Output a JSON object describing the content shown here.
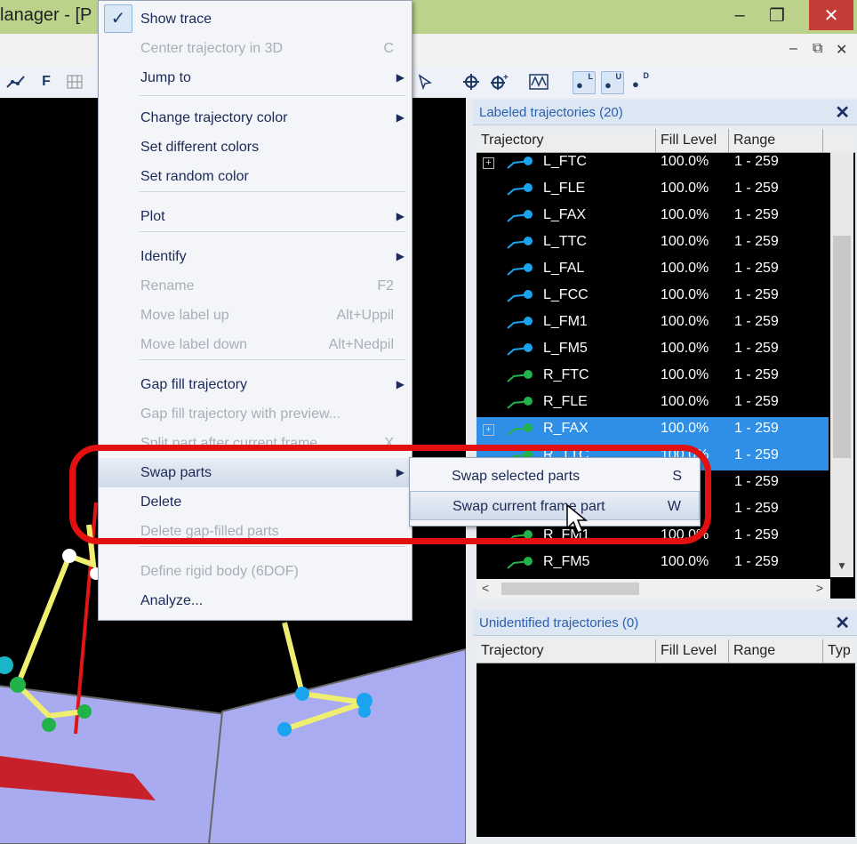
{
  "window": {
    "title": "lanager - [P",
    "controls": {
      "minimize": "–",
      "restore": "❐",
      "close": "✕"
    },
    "mdi_controls": {
      "minimize": "–",
      "restore": "⧉",
      "close": "✕"
    }
  },
  "toolbar": {
    "f_label": "F",
    "marker_labels": [
      "L",
      "U",
      "D"
    ]
  },
  "context_menu": {
    "items": [
      {
        "label": "Show trace",
        "shortcut": "",
        "submenu": false,
        "enabled": true,
        "checked": true
      },
      {
        "label": "Center trajectory in 3D",
        "shortcut": "C",
        "submenu": false,
        "enabled": false
      },
      {
        "label": "Jump to",
        "shortcut": "",
        "submenu": true,
        "enabled": true
      },
      {
        "label": "Change trajectory color",
        "shortcut": "",
        "submenu": true,
        "enabled": true
      },
      {
        "label": "Set different colors",
        "shortcut": "",
        "submenu": false,
        "enabled": true
      },
      {
        "label": "Set random color",
        "shortcut": "",
        "submenu": false,
        "enabled": true
      },
      {
        "label": "Plot",
        "shortcut": "",
        "submenu": true,
        "enabled": true
      },
      {
        "label": "Identify",
        "shortcut": "",
        "submenu": true,
        "enabled": true
      },
      {
        "label": "Rename",
        "shortcut": "F2",
        "submenu": false,
        "enabled": false
      },
      {
        "label": "Move label up",
        "shortcut": "Alt+Uppil",
        "submenu": false,
        "enabled": false
      },
      {
        "label": "Move label down",
        "shortcut": "Alt+Nedpil",
        "submenu": false,
        "enabled": false
      },
      {
        "label": "Gap fill trajectory",
        "shortcut": "",
        "submenu": true,
        "enabled": true
      },
      {
        "label": "Gap fill trajectory with preview...",
        "shortcut": "",
        "submenu": false,
        "enabled": false
      },
      {
        "label": "Split part after current frame",
        "shortcut": "X",
        "submenu": false,
        "enabled": false
      },
      {
        "label": "Swap parts",
        "shortcut": "",
        "submenu": true,
        "enabled": true,
        "highlighted": true
      },
      {
        "label": "Delete",
        "shortcut": "",
        "submenu": false,
        "enabled": true
      },
      {
        "label": "Delete gap-filled parts",
        "shortcut": "",
        "submenu": false,
        "enabled": false
      },
      {
        "label": "Define rigid body (6DOF)",
        "shortcut": "",
        "submenu": false,
        "enabled": false
      },
      {
        "label": "Analyze...",
        "shortcut": "",
        "submenu": false,
        "enabled": true
      }
    ],
    "check_glyph": "✓",
    "arrow_glyph": "▶"
  },
  "submenu": {
    "items": [
      {
        "label": "Swap selected parts",
        "shortcut": "S"
      },
      {
        "label": "Swap current frame part",
        "shortcut": "W",
        "hovered": true
      }
    ]
  },
  "labeled_panel": {
    "title": "Labeled trajectories (20)",
    "close": "✕",
    "columns": [
      "Trajectory",
      "Fill Level",
      "Range"
    ],
    "rows": [
      {
        "name": "L_FTC",
        "fill": "100.0%",
        "range": "1 - 259",
        "color": "#1aa4f0",
        "expand": "+",
        "selected": false
      },
      {
        "name": "L_FLE",
        "fill": "100.0%",
        "range": "1 - 259",
        "color": "#1aa4f0",
        "selected": false
      },
      {
        "name": "L_FAX",
        "fill": "100.0%",
        "range": "1 - 259",
        "color": "#1aa4f0",
        "selected": false
      },
      {
        "name": "L_TTC",
        "fill": "100.0%",
        "range": "1 - 259",
        "color": "#1aa4f0",
        "selected": false
      },
      {
        "name": "L_FAL",
        "fill": "100.0%",
        "range": "1 - 259",
        "color": "#1aa4f0",
        "selected": false
      },
      {
        "name": "L_FCC",
        "fill": "100.0%",
        "range": "1 - 259",
        "color": "#1aa4f0",
        "selected": false
      },
      {
        "name": "L_FM1",
        "fill": "100.0%",
        "range": "1 - 259",
        "color": "#1aa4f0",
        "selected": false
      },
      {
        "name": "L_FM5",
        "fill": "100.0%",
        "range": "1 - 259",
        "color": "#1aa4f0",
        "selected": false
      },
      {
        "name": "R_FTC",
        "fill": "100.0%",
        "range": "1 - 259",
        "color": "#21b24a",
        "selected": false
      },
      {
        "name": "R_FLE",
        "fill": "100.0%",
        "range": "1 - 259",
        "color": "#21b24a",
        "selected": false
      },
      {
        "name": "R_FAX",
        "fill": "100.0%",
        "range": "1 - 259",
        "color": "#21b24a",
        "expand": "+",
        "selected": true
      },
      {
        "name": "R_TTC",
        "fill": "100.0%",
        "range": "1 - 259",
        "color": "#21b24a",
        "selected": true
      },
      {
        "name": "",
        "fill": "",
        "range": "1 - 259",
        "color": "#21b24a",
        "selected": false
      },
      {
        "name": "",
        "fill": "",
        "range": "1 - 259",
        "color": "#21b24a",
        "selected": false
      },
      {
        "name": "R_FM1",
        "fill": "100.0%",
        "range": "1 - 259",
        "color": "#21b24a",
        "selected": false
      },
      {
        "name": "R_FM5",
        "fill": "100.0%",
        "range": "1 - 259",
        "color": "#21b24a",
        "selected": false
      }
    ]
  },
  "unidentified_panel": {
    "title": "Unidentified trajectories (0)",
    "close": "✕",
    "columns": [
      "Trajectory",
      "Fill Level",
      "Range",
      "Typ"
    ]
  }
}
